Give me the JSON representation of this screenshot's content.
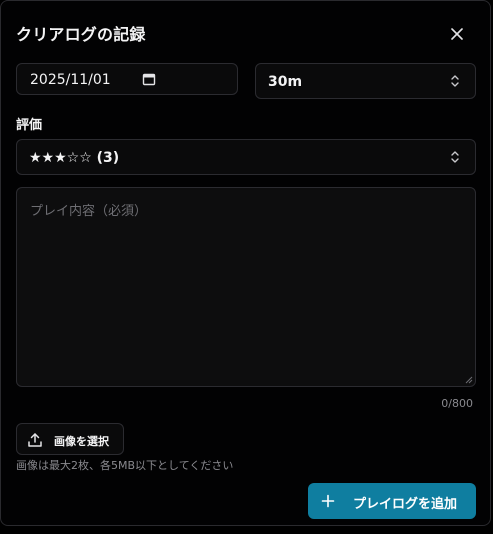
{
  "dialog": {
    "title": "クリアログの記録"
  },
  "form": {
    "date_value": "2025/11/01",
    "duration_value": "30m",
    "rating_label": "評価",
    "rating_value": "★★★☆☆ (3)",
    "content_placeholder": "プレイ内容（必須）",
    "char_counter": "0/800",
    "upload_label": "画像を選択",
    "upload_hint": "画像は最大2枚、各5MB以下としてください",
    "submit_label": "プレイログを追加"
  },
  "icons": {
    "close": "close-icon",
    "calendar": "calendar-icon",
    "select": "chevron-up-down-icon",
    "upload": "upload-icon",
    "add": "plus-icon"
  },
  "colors": {
    "background": "#000000",
    "field": "#0a0a0b",
    "border": "#2b2b30",
    "accent": "#0f7ea0",
    "muted_text": "#8a8a8f"
  }
}
